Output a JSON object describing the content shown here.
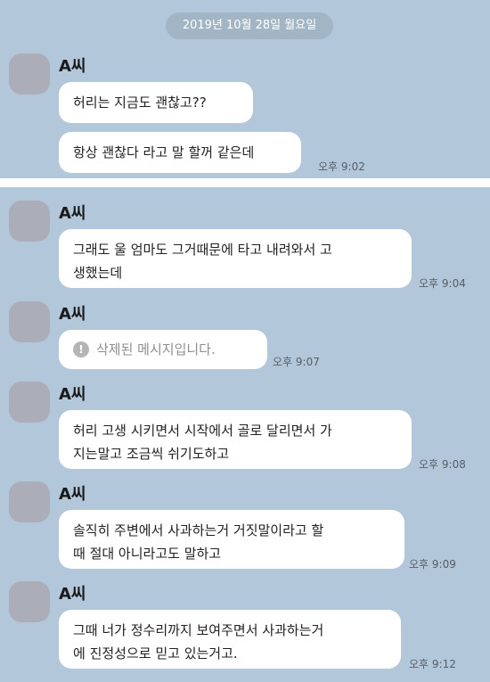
{
  "date_divider": "2019년 10월 28일 월요일",
  "groups": [
    {
      "sender": "A씨",
      "bubbles": [
        "허리는 지금도 괜찮고??",
        "항상 괜찮다 라고 말 할꺼 같은데"
      ],
      "time": "오후 9:02"
    },
    {
      "sender": "A씨",
      "bubbles": [
        "그래도 울 엄마도 그거때문에 타고 내려와서 고\n생했는데"
      ],
      "time": "오후 9:04"
    },
    {
      "sender": "A씨",
      "deleted_text": "삭제된 메시지입니다.",
      "time": "오후 9:07"
    },
    {
      "sender": "A씨",
      "bubbles": [
        "허리 고생 시키면서 시작에서 골로 달리면서 가\n지는말고 조금씩 쉬기도하고"
      ],
      "time": "오후 9:08"
    },
    {
      "sender": "A씨",
      "bubbles": [
        "솔직히 주변에서 사과하는거 거짓말이라고 할\n때 절대 아니라고도 말하고"
      ],
      "time": "오후 9:09"
    },
    {
      "sender": "A씨",
      "bubbles": [
        "그때 너가 정수리까지 보여주면서 사과하는거\n에 진정성으로 믿고 있는거고."
      ],
      "time": "오후 9:12"
    }
  ]
}
